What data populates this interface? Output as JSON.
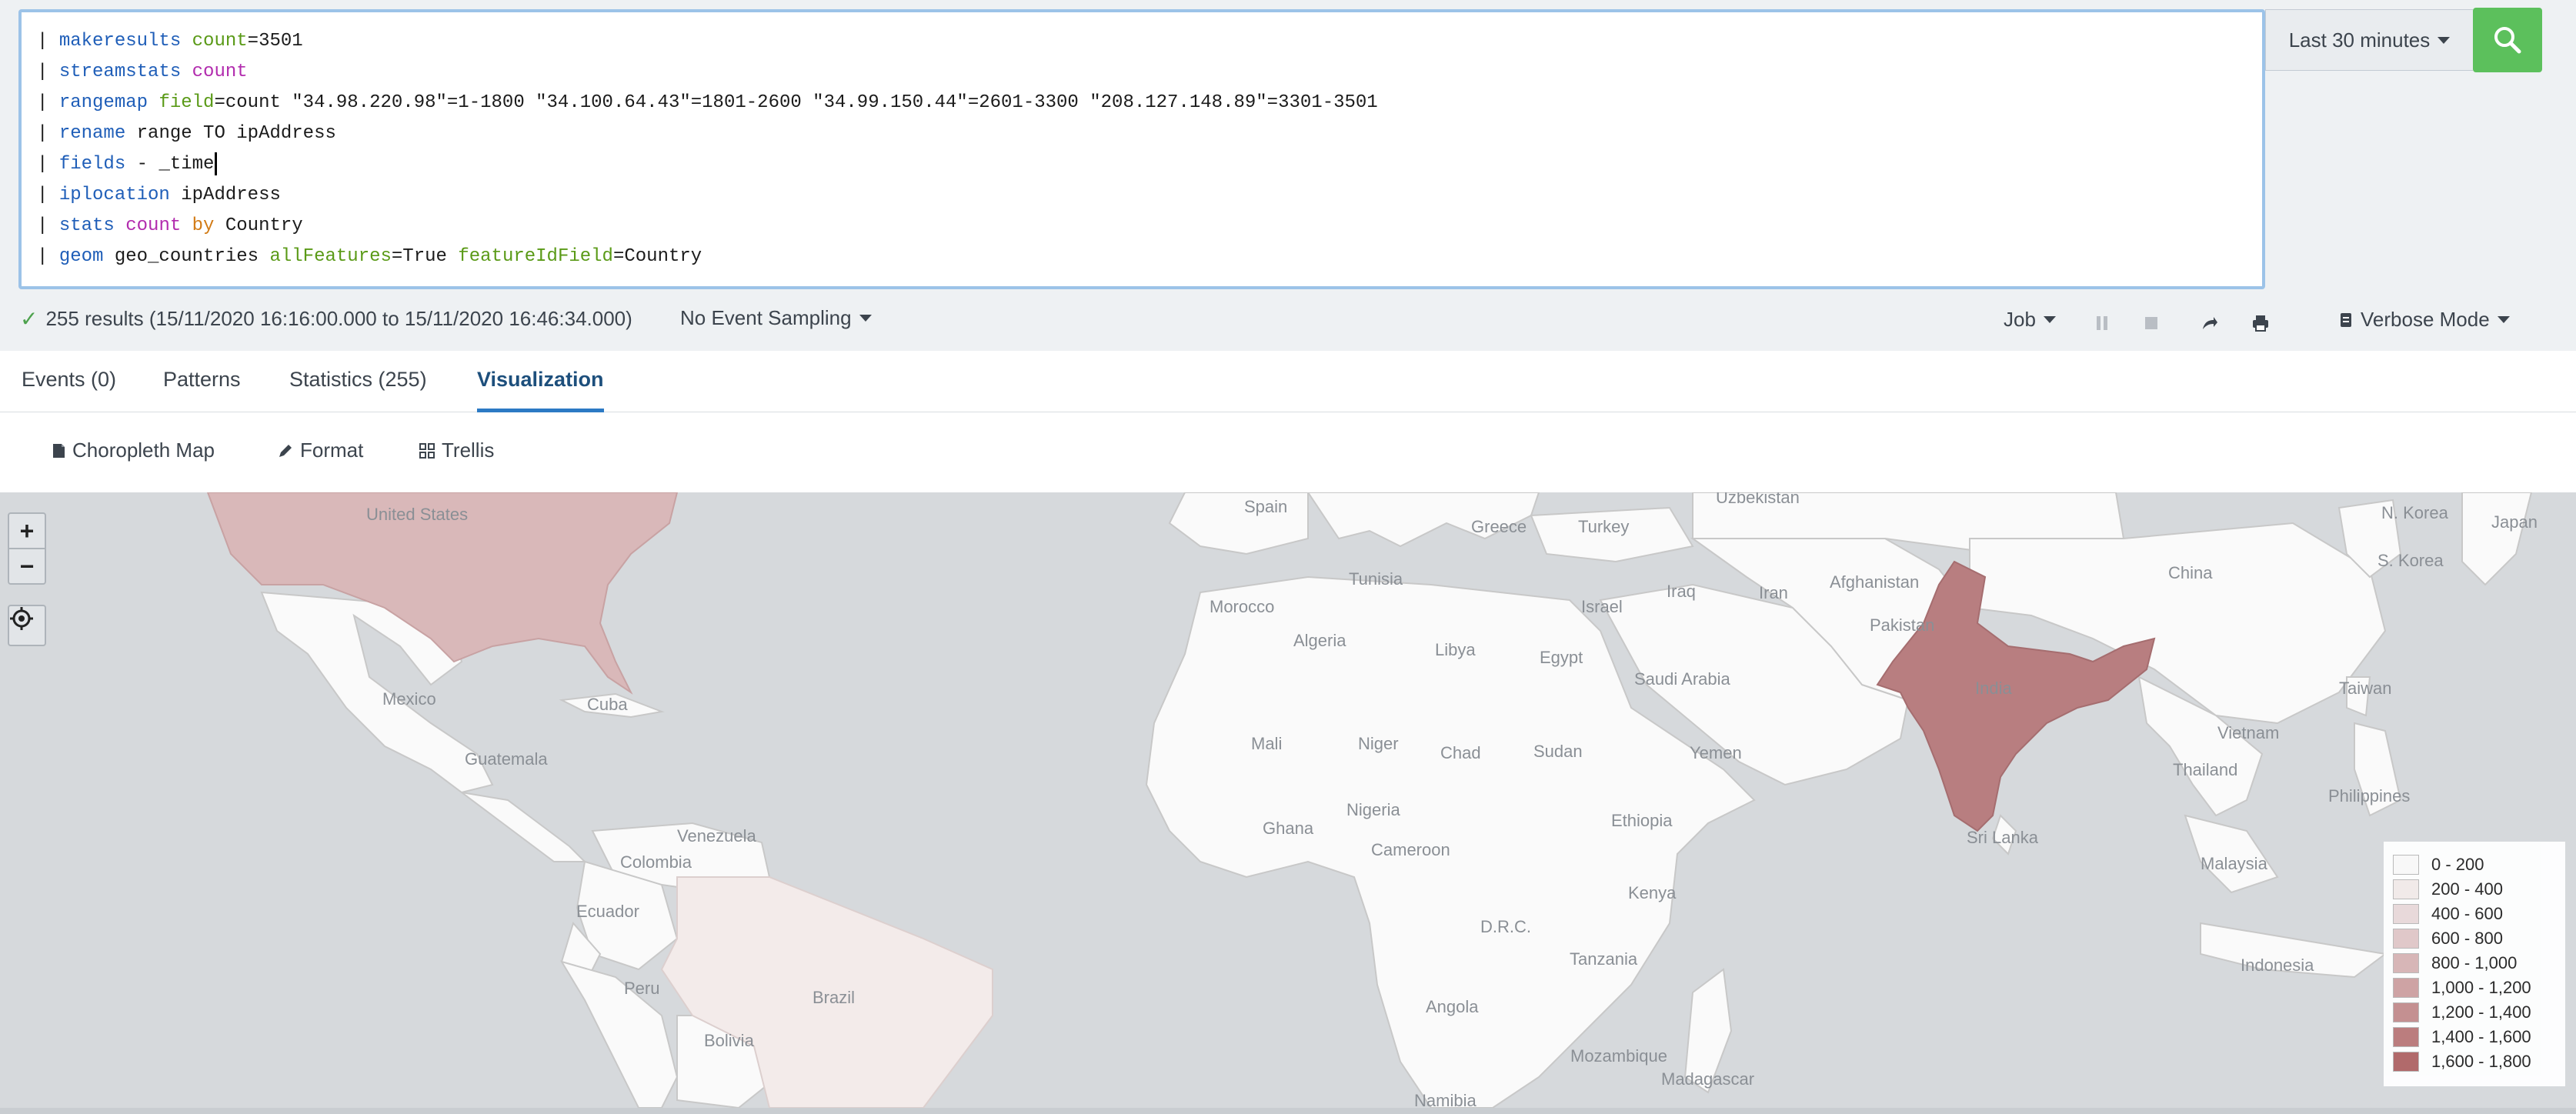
{
  "query": {
    "lines": [
      [
        {
          "t": "| ",
          "c": "pipe"
        },
        {
          "t": "makeresults",
          "c": "cmd"
        },
        {
          "t": " "
        },
        {
          "t": "count",
          "c": "arg"
        },
        {
          "t": "=3501"
        }
      ],
      [
        {
          "t": "| ",
          "c": "pipe"
        },
        {
          "t": "streamstats",
          "c": "cmd"
        },
        {
          "t": " "
        },
        {
          "t": "count",
          "c": "fn"
        }
      ],
      [
        {
          "t": "| ",
          "c": "pipe"
        },
        {
          "t": "rangemap",
          "c": "cmd"
        },
        {
          "t": " "
        },
        {
          "t": "field",
          "c": "arg"
        },
        {
          "t": "=count \"34.98.220.98\"=1-1800 \"34.100.64.43\"=1801-2600 \"34.99.150.44\"=2601-3300 \"208.127.148.89\"=3301-3501"
        }
      ],
      [
        {
          "t": "| ",
          "c": "pipe"
        },
        {
          "t": "rename",
          "c": "cmd"
        },
        {
          "t": " range TO ipAddress"
        }
      ],
      [
        {
          "t": "| ",
          "c": "pipe"
        },
        {
          "t": "fields",
          "c": "cmd"
        },
        {
          "t": " - _time"
        },
        {
          "t": "",
          "c": "cursor"
        }
      ],
      [
        {
          "t": "| ",
          "c": "pipe"
        },
        {
          "t": "iplocation",
          "c": "cmd"
        },
        {
          "t": " ipAddress"
        }
      ],
      [
        {
          "t": "| ",
          "c": "pipe"
        },
        {
          "t": "stats",
          "c": "cmd"
        },
        {
          "t": " "
        },
        {
          "t": "count",
          "c": "fn"
        },
        {
          "t": " "
        },
        {
          "t": "by",
          "c": "kw"
        },
        {
          "t": " Country"
        }
      ],
      [
        {
          "t": "| ",
          "c": "pipe"
        },
        {
          "t": "geom",
          "c": "cmd"
        },
        {
          "t": " geo_countries "
        },
        {
          "t": "allFeatures",
          "c": "arg"
        },
        {
          "t": "=True "
        },
        {
          "t": "featureIdField",
          "c": "arg"
        },
        {
          "t": "=Country"
        }
      ]
    ]
  },
  "time_picker": {
    "label": "Last 30 minutes"
  },
  "search_button": {
    "icon": "search-icon",
    "color": "#5cc05c"
  },
  "status": {
    "result_text": "255 results (15/11/2020 16:16:00.000 to 15/11/2020 16:46:34.000)",
    "sampling_label": "No Event Sampling",
    "job_label": "Job",
    "mode_label": "Verbose Mode"
  },
  "tabs": [
    {
      "label": "Events (0)",
      "active": false
    },
    {
      "label": "Patterns",
      "active": false
    },
    {
      "label": "Statistics (255)",
      "active": false
    },
    {
      "label": "Visualization",
      "active": true
    }
  ],
  "viz_toolbar": {
    "type_label": "Choropleth Map",
    "format_label": "Format",
    "trellis_label": "Trellis"
  },
  "map": {
    "colors": {
      "ocean": "#d6d9dc",
      "land": "#fafafa",
      "border": "#c8c8c8",
      "us": "#d9b8b9",
      "india": "#b87e80",
      "brazil": "#f3ebea"
    },
    "labels": [
      "United States",
      "Mexico",
      "Cuba",
      "Guatemala",
      "Venezuela",
      "Colombia",
      "Ecuador",
      "Peru",
      "Brazil",
      "Bolivia",
      "Spain",
      "Greece",
      "Turkey",
      "Uzbekistan",
      "Tunisia",
      "Morocco",
      "Algeria",
      "Libya",
      "Egypt",
      "Israel",
      "Iraq",
      "Iran",
      "Afghanistan",
      "Pakistan",
      "Saudi Arabia",
      "India",
      "China",
      "N. Korea",
      "S. Korea",
      "Japan",
      "Taiwan",
      "Vietnam",
      "Thailand",
      "Philippines",
      "Malaysia",
      "Indonesia",
      "Sri Lanka",
      "Mali",
      "Niger",
      "Chad",
      "Sudan",
      "Yemen",
      "Ethiopia",
      "Nigeria",
      "Ghana",
      "Cameroon",
      "Kenya",
      "D.R.C.",
      "Tanzania",
      "Angola",
      "Mozambique",
      "Madagascar",
      "Namibia"
    ],
    "legend": [
      {
        "label": "0 - 200",
        "color": "#fafafa"
      },
      {
        "label": "200 - 400",
        "color": "#f3ebea"
      },
      {
        "label": "400 - 600",
        "color": "#eadada"
      },
      {
        "label": "600 - 800",
        "color": "#e1c8c9"
      },
      {
        "label": "800 - 1,000",
        "color": "#d8b5b6"
      },
      {
        "label": "1,000 - 1,200",
        "color": "#cea1a2"
      },
      {
        "label": "1,200 - 1,400",
        "color": "#c48d8e"
      },
      {
        "label": "1,400 - 1,600",
        "color": "#ba7979"
      },
      {
        "label": "1,600 - 1,800",
        "color": "#b06566"
      }
    ]
  }
}
